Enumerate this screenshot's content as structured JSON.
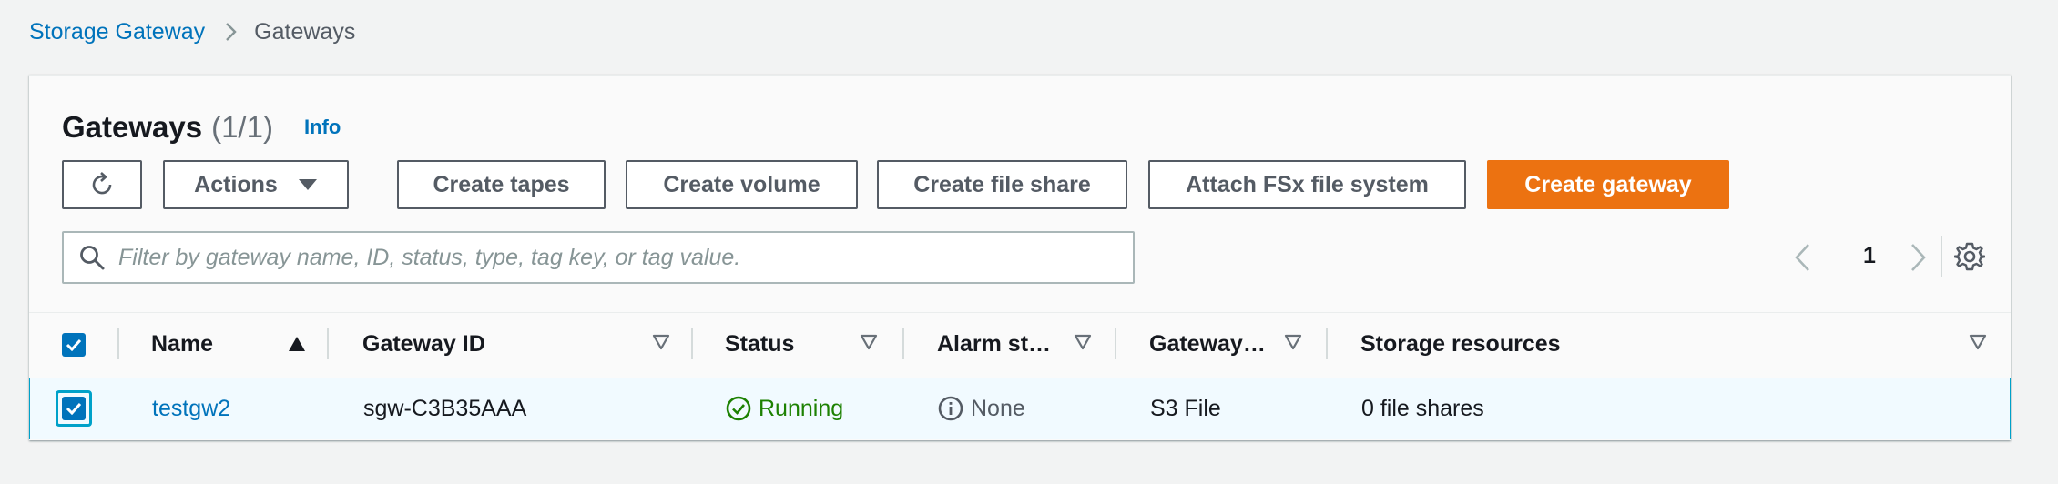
{
  "breadcrumb": {
    "root": "Storage Gateway",
    "current": "Gateways"
  },
  "header": {
    "title": "Gateways",
    "count": "(1/1)",
    "info": "Info"
  },
  "toolbar": {
    "actions": "Actions",
    "create_tapes": "Create tapes",
    "create_volume": "Create volume",
    "create_file_share": "Create file share",
    "attach_fsx": "Attach FSx file system",
    "create_gateway": "Create gateway"
  },
  "search": {
    "placeholder": "Filter by gateway name, ID, status, type, tag key, or tag value."
  },
  "pagination": {
    "current_page": "1"
  },
  "table": {
    "columns": {
      "name": "Name",
      "gateway_id": "Gateway ID",
      "status": "Status",
      "alarm_state": "Alarm st…",
      "gateway_type": "Gateway…",
      "storage_resources": "Storage resources"
    },
    "rows": [
      {
        "name": "testgw2",
        "gateway_id": "sgw-C3B35AAA",
        "status": "Running",
        "alarm_state": "None",
        "gateway_type": "S3 File",
        "storage_resources": "0 file shares",
        "selected": true
      }
    ]
  },
  "colors": {
    "link": "#0073bb",
    "primary": "#ec7211",
    "success": "#1d8102",
    "selected_row_bg": "#f1faff",
    "selected_row_border": "#00a1c9"
  }
}
